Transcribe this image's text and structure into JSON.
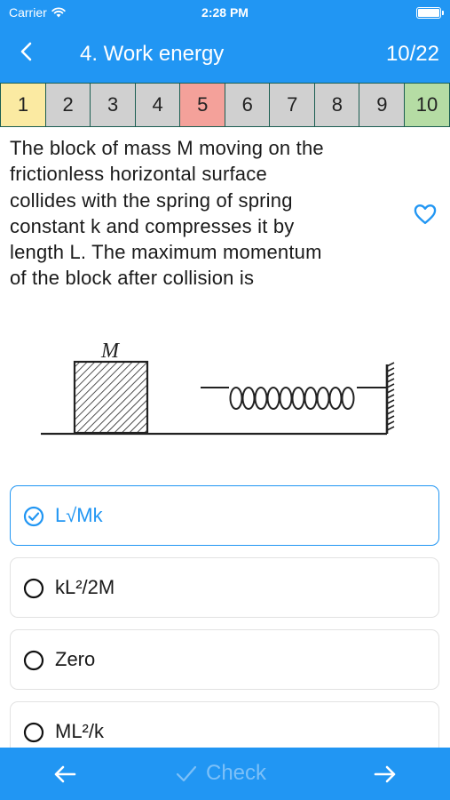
{
  "status": {
    "carrier": "Carrier",
    "time": "2:28 PM"
  },
  "header": {
    "title": "4. Work energy",
    "progress": "10/22"
  },
  "question_numbers": [
    {
      "label": "1",
      "state": "current"
    },
    {
      "label": "2",
      "state": "unanswered"
    },
    {
      "label": "3",
      "state": "unanswered"
    },
    {
      "label": "4",
      "state": "unanswered"
    },
    {
      "label": "5",
      "state": "wrong"
    },
    {
      "label": "6",
      "state": "unanswered"
    },
    {
      "label": "7",
      "state": "unanswered"
    },
    {
      "label": "8",
      "state": "unanswered"
    },
    {
      "label": "9",
      "state": "unanswered"
    },
    {
      "label": "10",
      "state": "correct"
    }
  ],
  "question": {
    "lines": [
      "The block of mass M moving on the",
      "frictionless horizontal surface",
      "collides with the spring of spring",
      "constant k and compresses it by",
      "length L. The maximum momentum",
      "of the block after collision is"
    ],
    "figure_label": "M"
  },
  "options": [
    {
      "text": "L√Mk",
      "selected": true
    },
    {
      "text": "kL²/2M",
      "selected": false
    },
    {
      "text": "Zero",
      "selected": false
    },
    {
      "text": "ML²/k",
      "selected": false
    }
  ],
  "footer": {
    "check_label": "Check"
  },
  "colors": {
    "accent": "#2196f3",
    "current": "#fbeaa2",
    "wrong": "#f4a19a",
    "correct": "#b5dca4",
    "unanswered": "#d0d0d0"
  },
  "icons": {
    "back": "chevron-left-icon",
    "favorite": "heart-outline-icon",
    "prev": "arrow-left-icon",
    "next": "arrow-right-icon",
    "check": "checkmark-icon"
  }
}
